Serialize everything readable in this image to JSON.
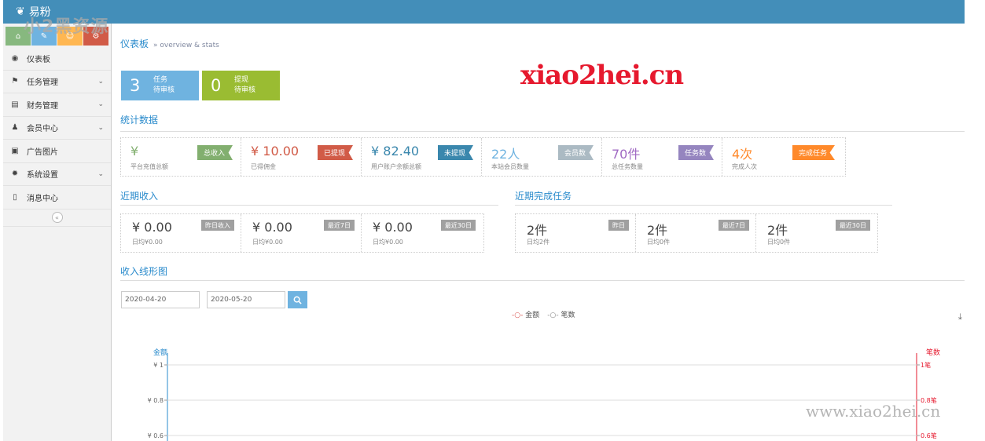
{
  "app": {
    "brand": "易粉",
    "watermark_top": "小2黑资源",
    "watermark_logo": "xiao2hei.cn",
    "watermark_bottom": "www.xiao2hei.cn",
    "brand_color": "#438eb9"
  },
  "shortcuts": [
    {
      "icon": "home-icon",
      "glyph": "⌂",
      "color": "#87b87f"
    },
    {
      "icon": "pencil-icon",
      "glyph": "✎",
      "color": "#6fb3e0"
    },
    {
      "icon": "users-icon",
      "glyph": "☺",
      "color": "#ffb752"
    },
    {
      "icon": "cogs-icon",
      "glyph": "⚙",
      "color": "#d15b47"
    }
  ],
  "menu": [
    {
      "label": "仪表板",
      "icon": "dashboard-icon",
      "glyph": "◉",
      "chevron": false
    },
    {
      "label": "任务管理",
      "icon": "flag-icon",
      "glyph": "⚑",
      "chevron": true
    },
    {
      "label": "财务管理",
      "icon": "print-icon",
      "glyph": "▤",
      "chevron": true
    },
    {
      "label": "会员中心",
      "icon": "user-icon",
      "glyph": "♟",
      "chevron": true
    },
    {
      "label": "广告图片",
      "icon": "picture-icon",
      "glyph": "▣",
      "chevron": false
    },
    {
      "label": "系统设置",
      "icon": "gear-icon",
      "glyph": "✹",
      "chevron": true
    },
    {
      "label": "消息中心",
      "icon": "bookmark-icon",
      "glyph": "▯",
      "chevron": false
    }
  ],
  "breadcrumb": {
    "title": "仪表板",
    "sub": "» overview & stats"
  },
  "pending": [
    {
      "num": "3",
      "l1": "任务",
      "l2": "待审核",
      "color": "#6fb3e0"
    },
    {
      "num": "0",
      "l1": "提现",
      "l2": "待审核",
      "color": "#9abc32"
    }
  ],
  "sections": {
    "stats": "统计数据",
    "recent_income": "近期收入",
    "recent_tasks": "近期完成任务",
    "income_chart": "收入线形图"
  },
  "stats": [
    {
      "value": "¥",
      "desc": "平台充值总额",
      "tag": "总收入",
      "color": "#82af6f"
    },
    {
      "value": "¥ 10.00",
      "desc": "已得佣金",
      "tag": "已提现",
      "color": "#d15b47"
    },
    {
      "value": "¥ 82.40",
      "desc": "用户账户余额总额",
      "tag": "未提现",
      "color": "#3a87ad"
    },
    {
      "value": "22人",
      "desc": "本站会员数量",
      "tag": "会员数",
      "color": "#abbac3"
    },
    {
      "value": "70件",
      "desc": "总任务数量",
      "tag": "任务数",
      "color": "#9585bf"
    },
    {
      "value": "4次",
      "desc": "完成人次",
      "tag": "完成任务",
      "color": "#ff892a"
    }
  ],
  "stat_value_colors": [
    "#82af6f",
    "#d15b47",
    "#3a87ad",
    "#6fb3e0",
    "#a069c3",
    "#ff892a"
  ],
  "income": [
    {
      "value": "¥ 0.00",
      "desc": "日均¥0.00",
      "tag": "昨日收入"
    },
    {
      "value": "¥ 0.00",
      "desc": "日均¥0.00",
      "tag": "最近7日"
    },
    {
      "value": "¥ 0.00",
      "desc": "日均¥0.00",
      "tag": "最近30日"
    }
  ],
  "tasks": [
    {
      "value": "2件",
      "desc": "日均2件",
      "tag": "昨日"
    },
    {
      "value": "2件",
      "desc": "日均0件",
      "tag": "最近7日"
    },
    {
      "value": "2件",
      "desc": "日均0件",
      "tag": "最近30日"
    }
  ],
  "filter": {
    "start": "2020-04-20",
    "end": "2020-05-20"
  },
  "chart_data": {
    "type": "line",
    "legend": [
      "金额",
      "笔数"
    ],
    "series_colors": [
      "#d9534f",
      "#888888"
    ],
    "left_axis": {
      "label": "金额",
      "ticks": [
        "¥ 1",
        "¥ 0.8",
        "¥ 0.6"
      ],
      "ylim": [
        0,
        1
      ],
      "color": "#2a8bcc"
    },
    "right_axis": {
      "label": "笔数",
      "ticks": [
        "1笔",
        "0.8笔",
        "0.6笔"
      ],
      "ylim": [
        0,
        1
      ],
      "color": "#e6192e"
    },
    "series": [
      {
        "name": "金额",
        "values": []
      },
      {
        "name": "笔数",
        "values": []
      }
    ]
  }
}
